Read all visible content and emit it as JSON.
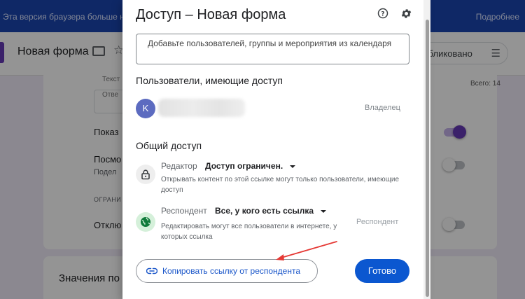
{
  "browser_banner": {
    "message": "Эта версия браузера больше н",
    "more_link": "Подробнее"
  },
  "form_header": {
    "title": "Новая форма",
    "publish_label": "убликовано",
    "logo_color": "#673ab7"
  },
  "background": {
    "text_label": "Текст",
    "answer_placeholder": "Отве",
    "total": "Всего: 14",
    "show_label": "Показ",
    "view_label": "Посмо",
    "share_label": "Подел",
    "restrictions_label": "ОГРАНИ",
    "disable_label": "Отклю",
    "values_label": "Значения по",
    "toggles": [
      true,
      false,
      false
    ]
  },
  "dialog": {
    "title": "Доступ – Новая форма",
    "help_icon": "help-circle-icon",
    "settings_icon": "gear-icon",
    "add_placeholder": "Добавьте пользователей, группы и мероприятия из календаря",
    "users_heading": "Пользователи, имеющие доступ",
    "users": [
      {
        "avatar_letter": "K",
        "role": "Владелец",
        "avatar_color": "#5c6bc0"
      }
    ],
    "general_heading": "Общий доступ",
    "editor": {
      "label": "Редактор",
      "value": "Доступ ограничен.",
      "description": "Открывать контент по этой ссылке могут только пользователи, имеющие доступ",
      "icon": "lock-icon"
    },
    "respondent": {
      "label": "Респондент",
      "value": "Все, у кого есть ссылка",
      "description": "Редактировать могут все пользователи в интернете, у которых ссылка",
      "role": "Респондент",
      "icon": "globe-icon"
    },
    "copy_button": "Копировать ссылку от респондента",
    "done_button": "Готово",
    "accent_color": "#0b57d0",
    "annotation_arrow_color": "#e53935"
  }
}
